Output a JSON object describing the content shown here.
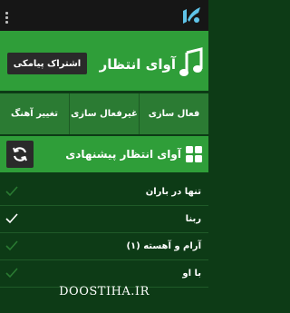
{
  "topbar": {
    "menu_icon": "overflow-menu-icon",
    "logo_icon": "app-logo-icon"
  },
  "player": {
    "title": "آوای انتظار",
    "subscribe_label": "اشتراک پیامکی",
    "icon": "music-note-icon"
  },
  "actions": [
    {
      "label": "تغییر آهنگ"
    },
    {
      "label": "غیرفعال سازی"
    },
    {
      "label": "فعال سازی"
    }
  ],
  "suggestions": {
    "title": "آوای انتظار پیشنهادی",
    "icon": "grid-icon",
    "refresh_icon": "refresh-icon",
    "items": [
      {
        "title": "تنها در باران",
        "checked": false
      },
      {
        "title": "ربنا",
        "checked": true
      },
      {
        "title": "آرام و آهسته (۱)",
        "checked": false
      },
      {
        "title": "با او",
        "checked": false
      }
    ]
  },
  "watermark": "DOOSTIHA.IR",
  "colors": {
    "accent": "#2f9e39",
    "dark_bar": "#2b7b33",
    "background": "#0d3b16",
    "button": "#2a2a2a"
  }
}
